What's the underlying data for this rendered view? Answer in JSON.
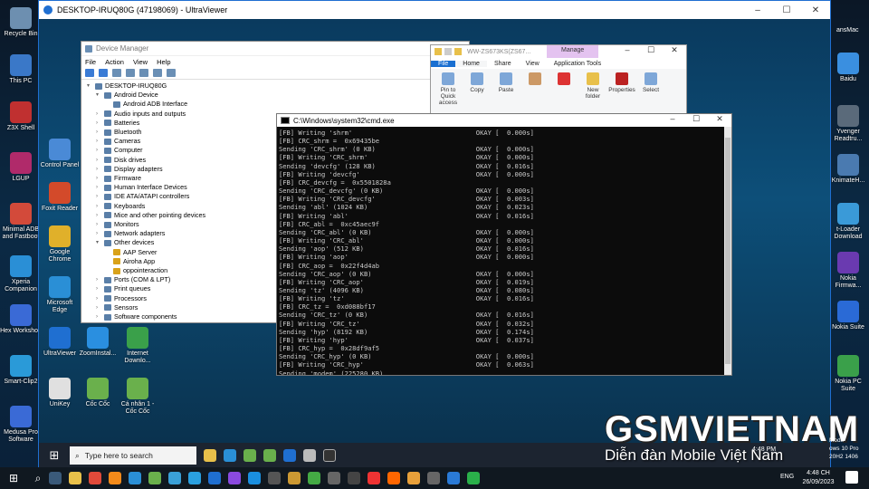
{
  "host": {
    "desktop_icons_left": [
      "Recycle Bin",
      "This PC",
      "Z3X Shell",
      "LGUP",
      "Minimal ADB and Fastboot",
      "Xperia Companion",
      "Hex Workshop",
      "Smart-Clip2",
      "Medusa Pro Software"
    ],
    "desktop_icons_right": [
      "Baidu",
      "Yvenger Readtru...",
      "KnimateH...",
      "t-Loader Download",
      "Nokia Firmwa...",
      "Nokia Suite",
      "Nokia PC Suite"
    ],
    "right_edge_partial": "ansMac",
    "tray": {
      "lang": "ENG",
      "time": "4:48 CH",
      "date": "26/09/2023",
      "notif_partial": "ows 10 Pro",
      "build_partial": "20H2 1406",
      "mode_partial": "Mode",
      "remote_time": "4:48 PM"
    }
  },
  "ultraviewer": {
    "title": "DESKTOP-IRUQ80G (47198069) - UltraViewer",
    "buttons": [
      "–",
      "☐",
      "✕"
    ]
  },
  "remote_desktop_icons": {
    "col1": [
      "Control Panel",
      "Foxit Reader",
      "Google Chrome",
      "Microsoft Edge",
      "UltraViewer",
      "UniKey"
    ],
    "col2": [
      "ZoomInstal...",
      "Cốc Cốc"
    ],
    "col3": [
      "Internet Downlo...",
      "Cá nhân 1 - Cốc Cốc"
    ]
  },
  "device_manager": {
    "title": "Device Manager",
    "menu": [
      "File",
      "Action",
      "View",
      "Help"
    ],
    "tree": [
      {
        "label": "DESKTOP-IRUQ80G",
        "level": 0,
        "exp": "▾"
      },
      {
        "label": "Android Device",
        "level": 1,
        "exp": "▾"
      },
      {
        "label": "Android ADB Interface",
        "level": 2,
        "exp": ""
      },
      {
        "label": "Audio inputs and outputs",
        "level": 1,
        "exp": "›"
      },
      {
        "label": "Batteries",
        "level": 1,
        "exp": "›"
      },
      {
        "label": "Bluetooth",
        "level": 1,
        "exp": "›"
      },
      {
        "label": "Cameras",
        "level": 1,
        "exp": "›"
      },
      {
        "label": "Computer",
        "level": 1,
        "exp": "›"
      },
      {
        "label": "Disk drives",
        "level": 1,
        "exp": "›"
      },
      {
        "label": "Display adapters",
        "level": 1,
        "exp": "›"
      },
      {
        "label": "Firmware",
        "level": 1,
        "exp": "›"
      },
      {
        "label": "Human Interface Devices",
        "level": 1,
        "exp": "›"
      },
      {
        "label": "IDE ATA/ATAPI controllers",
        "level": 1,
        "exp": "›"
      },
      {
        "label": "Keyboards",
        "level": 1,
        "exp": "›"
      },
      {
        "label": "Mice and other pointing devices",
        "level": 1,
        "exp": "›"
      },
      {
        "label": "Monitors",
        "level": 1,
        "exp": "›"
      },
      {
        "label": "Network adapters",
        "level": 1,
        "exp": "›"
      },
      {
        "label": "Other devices",
        "level": 1,
        "exp": "▾"
      },
      {
        "label": "AAP Server",
        "level": 2,
        "exp": ""
      },
      {
        "label": "Airoha App",
        "level": 2,
        "exp": ""
      },
      {
        "label": "oppointeraction",
        "level": 2,
        "exp": ""
      },
      {
        "label": "Ports (COM & LPT)",
        "level": 1,
        "exp": "›"
      },
      {
        "label": "Print queues",
        "level": 1,
        "exp": "›"
      },
      {
        "label": "Processors",
        "level": 1,
        "exp": "›"
      },
      {
        "label": "Sensors",
        "level": 1,
        "exp": "›"
      },
      {
        "label": "Software components",
        "level": 1,
        "exp": "›"
      }
    ]
  },
  "explorer": {
    "title": "WW-ZS673KS(ZS67...",
    "manage": "Manage",
    "tabs": [
      "File",
      "Home",
      "Share",
      "View",
      "Application Tools"
    ],
    "ribbon": [
      "Pin to Quick access",
      "Copy",
      "Paste",
      "",
      "",
      "New folder",
      "Properties",
      "Select"
    ]
  },
  "cmd": {
    "title": "C:\\Windows\\system32\\cmd.exe",
    "lines": [
      "[FB] Writing 'shrm'                                OKAY [  0.000s]",
      "[FB] CRC_shrm =  0x69435be",
      "Sending 'CRC_shrm' (0 KB)                          OKAY [  0.000s]",
      "[FB] Writing 'CRC_shrm'                            OKAY [  0.000s]",
      "Sending 'devcfg' (128 KB)                          OKAY [  0.016s]",
      "[FB] Writing 'devcfg'                              OKAY [  0.000s]",
      "[FB] CRC_devcfg =  0x5501828a",
      "Sending 'CRC_devcfg' (0 KB)                        OKAY [  0.000s]",
      "[FB] Writing 'CRC_devcfg'                          OKAY [  0.003s]",
      "Sending 'abl' (1024 KB)                            OKAY [  0.023s]",
      "[FB] Writing 'abl'                                 OKAY [  0.016s]",
      "[FB] CRC_abl =  0xc45aec9f",
      "Sending 'CRC_abl' (0 KB)                           OKAY [  0.000s]",
      "[FB] Writing 'CRC_abl'                             OKAY [  0.000s]",
      "Sending 'aop' (512 KB)                             OKAY [  0.016s]",
      "[FB] Writing 'aop'                                 OKAY [  0.000s]",
      "[FB] CRC_aop =  0x22f4d4ab",
      "Sending 'CRC_aop' (0 KB)                           OKAY [  0.000s]",
      "[FB] Writing 'CRC_aop'                             OKAY [  0.019s]",
      "Sending 'tz' (4096 KB)                             OKAY [  0.080s]",
      "[FB] Writing 'tz'                                  OKAY [  0.016s]",
      "[FB] CRC_tz =  0xd088bf17",
      "Sending 'CRC_tz' (0 KB)                            OKAY [  0.016s]",
      "[FB] Writing 'CRC_tz'                              OKAY [  0.032s]",
      "Sending 'hyp' (8192 KB)                            OKAY [  0.174s]",
      "[FB] Writing 'hyp'                                 OKAY [  0.037s]",
      "[FB] CRC_hyp =  0x28df9af5",
      "Sending 'CRC_hyp' (0 KB)                           OKAY [  0.000s]",
      "[FB] Writing 'CRC_hyp'                             OKAY [  0.063s]",
      "Sending 'modem' (225280 KB)"
    ]
  },
  "remote_taskbar": {
    "search_placeholder": "Type here to search"
  },
  "watermark": {
    "main": "GSMVIETNAM",
    "sub": "Diễn đàn Mobile Việt Nam"
  }
}
